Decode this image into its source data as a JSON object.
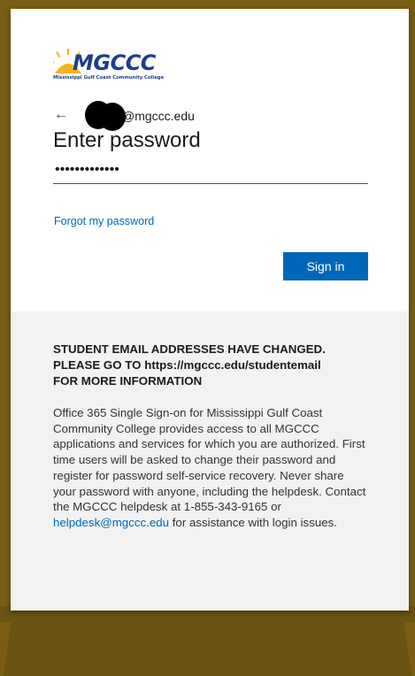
{
  "logo": {
    "name": "MGCCC",
    "subtitle": "Mississippi Gulf Coast Community College"
  },
  "identity": {
    "email_suffix": "@mgccc.edu"
  },
  "title": "Enter password",
  "password": {
    "value": "•••••••••••••"
  },
  "forgot_link": "Forgot my password",
  "sign_in_label": "Sign in",
  "notice": {
    "line1": "STUDENT EMAIL ADDRESSES HAVE CHANGED.",
    "line2": "PLEASE GO TO https://mgccc.edu/studentemail",
    "line3": "FOR MORE INFORMATION"
  },
  "description": {
    "text_before": "Office 365 Single Sign-on for Mississippi Gulf Coast Community College provides access to all MGCCC applications and services for which you are authorized. First time users will be asked to change their password and register for password self-service recovery. Never share your password with anyone, including the helpdesk. Contact the MGCCC helpdesk at 1-855-343-9165 or",
    "email_link": "helpdesk@mgccc.edu",
    "text_after": "for assistance with login issues."
  },
  "colors": {
    "accent": "#0067b8",
    "brand_blue": "#1f3d8c",
    "brand_gold": "#f2b51c",
    "frame_gold": "#7a5d14"
  }
}
